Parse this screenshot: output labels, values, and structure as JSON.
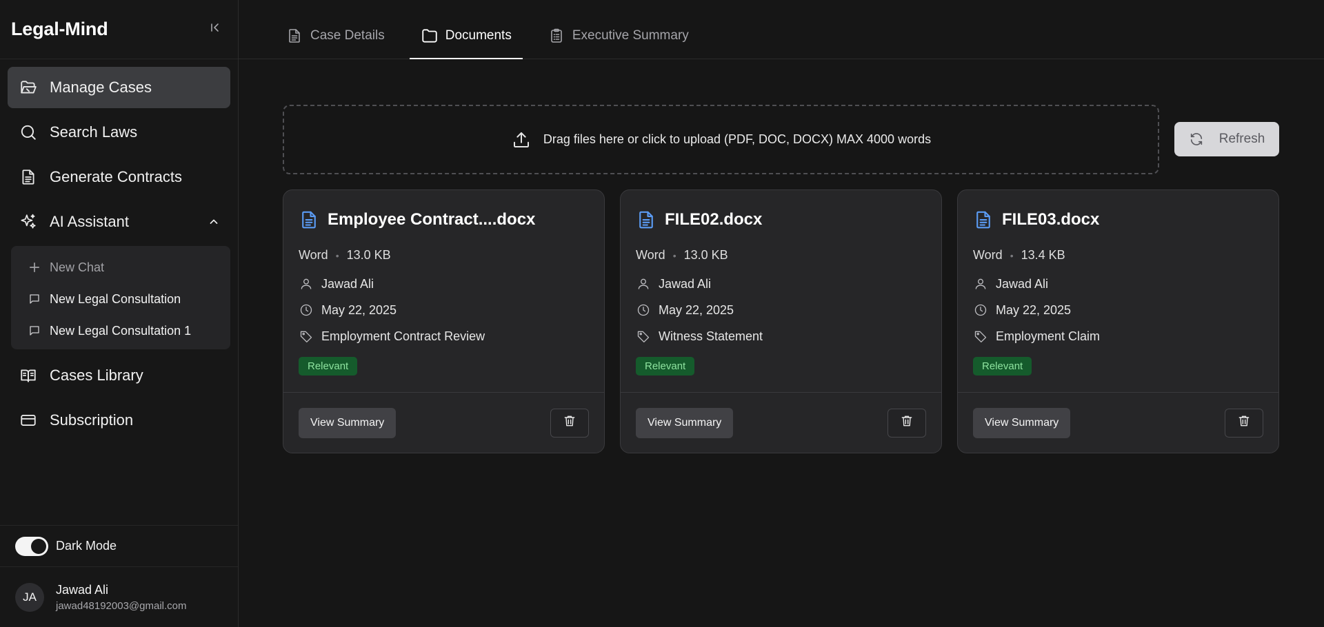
{
  "app": {
    "title": "Legal-Mind"
  },
  "sidebar": {
    "items": [
      {
        "label": "Manage Cases",
        "icon": "folder-open-icon",
        "active": true
      },
      {
        "label": "Search Laws",
        "icon": "search-icon"
      },
      {
        "label": "Generate Contracts",
        "icon": "document-icon"
      },
      {
        "label": "AI Assistant",
        "icon": "sparkles-icon",
        "expanded": true
      },
      {
        "label": "Cases Library",
        "icon": "book-open-icon"
      },
      {
        "label": "Subscription",
        "icon": "credit-card-icon"
      }
    ],
    "ai_submenu": [
      {
        "label": "New Chat",
        "icon": "plus-icon"
      },
      {
        "label": "New Legal Consultation",
        "icon": "chat-icon"
      },
      {
        "label": "New Legal Consultation 1",
        "icon": "chat-icon"
      }
    ],
    "dark_mode": {
      "label": "Dark Mode",
      "enabled": true
    },
    "user": {
      "initials": "JA",
      "name": "Jawad Ali",
      "email": "jawad48192003@gmail.com"
    }
  },
  "tabs": [
    {
      "label": "Case Details",
      "icon": "document-icon"
    },
    {
      "label": "Documents",
      "icon": "folder-icon",
      "active": true
    },
    {
      "label": "Executive Summary",
      "icon": "clipboard-icon"
    }
  ],
  "upload": {
    "text": "Drag files here or click to upload (PDF, DOC, DOCX) MAX 4000 words",
    "icon": "upload-icon"
  },
  "refresh": {
    "label": "Refresh",
    "icon": "refresh-icon"
  },
  "documents": [
    {
      "name": "Employee Contract....docx",
      "type": "Word",
      "size": "13.0 KB",
      "owner": "Jawad Ali",
      "date": "May 22, 2025",
      "tag": "Employment Contract Review",
      "status": "Relevant",
      "view_label": "View Summary"
    },
    {
      "name": "FILE02.docx",
      "type": "Word",
      "size": "13.0 KB",
      "owner": "Jawad Ali",
      "date": "May 22, 2025",
      "tag": "Witness Statement",
      "status": "Relevant",
      "view_label": "View Summary"
    },
    {
      "name": "FILE03.docx",
      "type": "Word",
      "size": "13.4 KB",
      "owner": "Jawad Ali",
      "date": "May 22, 2025",
      "tag": "Employment Claim",
      "status": "Relevant",
      "view_label": "View Summary"
    }
  ],
  "colors": {
    "accent_blue": "#5b9cf5",
    "badge_bg": "#155b2c",
    "badge_text": "#8ee39f"
  }
}
